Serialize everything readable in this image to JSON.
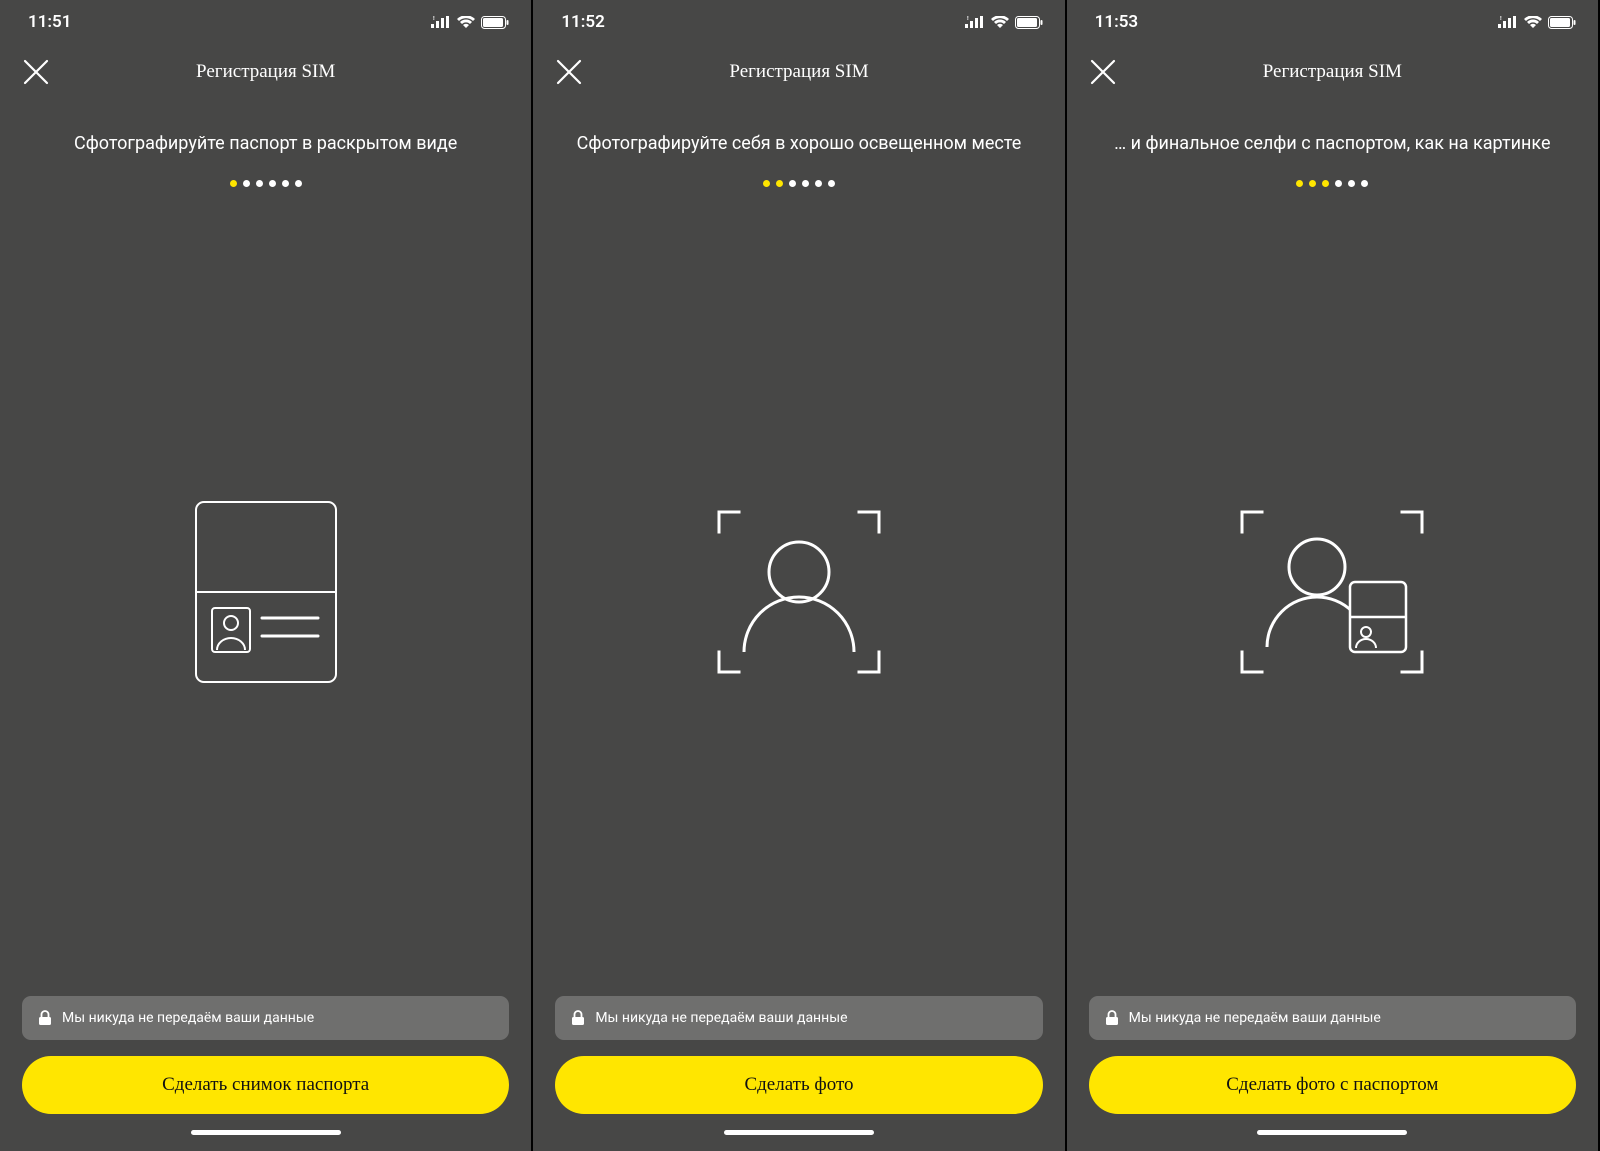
{
  "colors": {
    "accent": "#ffe600",
    "bg": "#474746"
  },
  "screens": [
    {
      "time": "11:51",
      "title": "Регистрация SIM",
      "instruction": "Сфотографируйте паспорт в раскрытом виде",
      "progress": {
        "total": 6,
        "active": 1
      },
      "privacy": "Мы никуда не передаём ваши данные",
      "cta": "Сделать снимок паспорта",
      "illustration": "passport"
    },
    {
      "time": "11:52",
      "title": "Регистрация SIM",
      "instruction": "Сфотографируйте себя в хорошо освещенном месте",
      "progress": {
        "total": 6,
        "active": 2
      },
      "privacy": "Мы никуда не передаём ваши данные",
      "cta": "Сделать фото",
      "illustration": "selfie"
    },
    {
      "time": "11:53",
      "title": "Регистрация SIM",
      "instruction": "… и финальное селфи с паспортом, как на картинке",
      "progress": {
        "total": 6,
        "active": 3
      },
      "privacy": "Мы никуда не передаём ваши данные",
      "cta": "Сделать фото с паспортом",
      "illustration": "selfie-passport"
    }
  ]
}
